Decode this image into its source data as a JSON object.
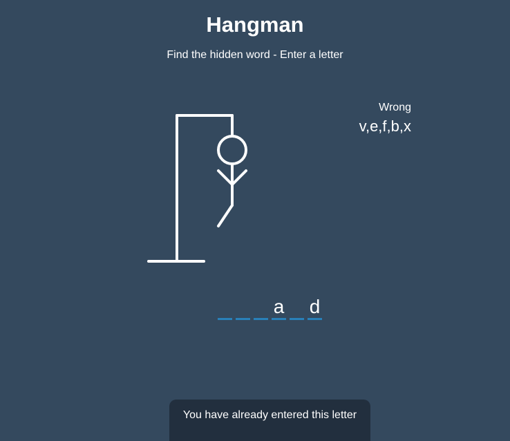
{
  "header": {
    "title": "Hangman",
    "subtitle": "Find the hidden word - Enter a letter"
  },
  "wrong": {
    "label": "Wrong",
    "letters": "v,e,f,b,x"
  },
  "word": {
    "slots": [
      "",
      "",
      "",
      "a",
      "",
      "d"
    ]
  },
  "notification": {
    "message": "You have already entered this letter"
  },
  "colors": {
    "background": "#34495e",
    "figure": "#ffffff",
    "slot_underline": "#2980b9",
    "notification_background": "#222f3e"
  },
  "game": {
    "wrong_count": 5,
    "parts_drawn": [
      "head",
      "body",
      "left-arm",
      "right-arm",
      "left-leg"
    ]
  }
}
